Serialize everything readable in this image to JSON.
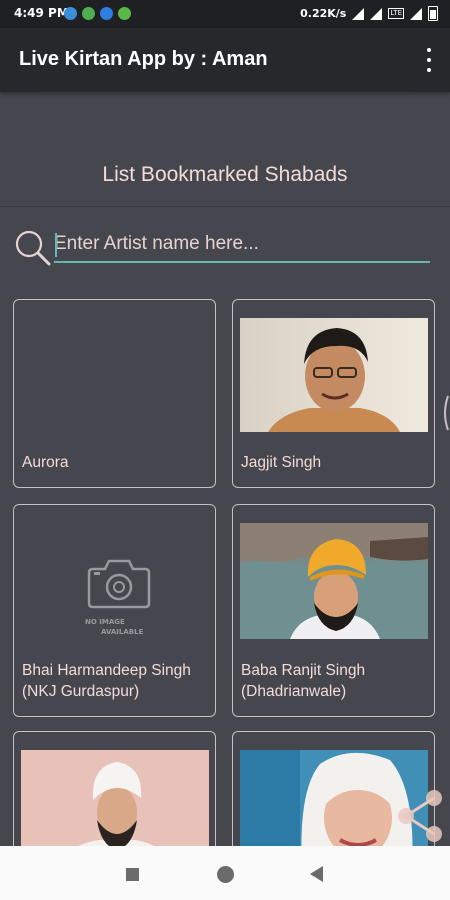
{
  "status_bar": {
    "time": "4:49 PM",
    "network_speed": "0.22K/s",
    "network_type": "LTE",
    "icons": [
      "app-notification-icon",
      "globe-notification-icon",
      "chat-notification-icon",
      "check-notification-icon",
      "wifi-icon",
      "signal-icon",
      "battery-icon"
    ]
  },
  "app_bar": {
    "title": "Live Kirtan App by : Aman",
    "menu_icon": "more-vert-icon"
  },
  "page": {
    "title": "List Bookmarked Shabads"
  },
  "search": {
    "placeholder": "Enter Artist name here...",
    "value": "",
    "icon": "search-icon",
    "accent_color": "#67b8b0"
  },
  "artists": [
    {
      "name": "Aurora",
      "image": "none"
    },
    {
      "name": "Jagjit Singh",
      "image": "photo"
    },
    {
      "name": "Bhai Harmandeep Singh (NKJ Gurdaspur)",
      "image": "no-image-available"
    },
    {
      "name": "Baba Ranjit Singh (Dhadrianwale)",
      "image": "photo"
    },
    {
      "name": "",
      "image": "photo"
    },
    {
      "name": "",
      "image": "photo"
    }
  ],
  "placeholder_image": {
    "line1": "NO IMAGE",
    "line2": "AVAILABLE"
  },
  "colors": {
    "background": "#45464e",
    "app_bar": "#27282c",
    "text": "#f2dcd6",
    "card_border": "#c8bfbf"
  },
  "nav_bar": {
    "icons": [
      "recent-apps-icon",
      "home-icon",
      "back-icon"
    ]
  }
}
